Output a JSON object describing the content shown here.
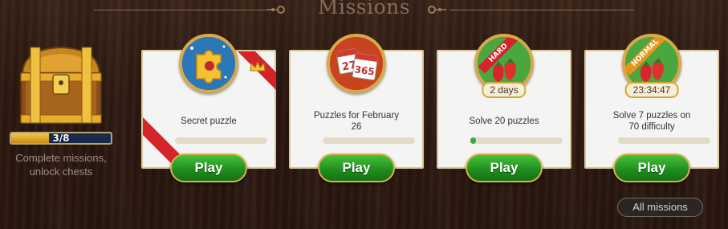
{
  "header": {
    "title": "Missions"
  },
  "chest": {
    "progress_label": "3/8",
    "progress_fraction": 0.375,
    "caption_line1": "Complete missions,",
    "caption_line2": "unlock chests"
  },
  "missions": [
    {
      "label": "Secret puzzle",
      "label2": "",
      "progress": 0,
      "play_label": "Play",
      "icon": "puzzle-piece-icon"
    },
    {
      "label": "Puzzles for February",
      "label2": "26",
      "progress": 0,
      "play_label": "Play",
      "icon": "calendar-icon",
      "cal_a": "27",
      "cal_b": "365"
    },
    {
      "label": "Solve 20 puzzles",
      "label2": "",
      "progress": 0.05,
      "play_label": "Play",
      "icon": "strawberry-icon",
      "ribbon": "HARD",
      "time_tag": "2 days"
    },
    {
      "label": "Solve 7 puzzles on",
      "label2": "70 difficulty",
      "progress": 0,
      "play_label": "Play",
      "icon": "strawberry-icon",
      "ribbon": "NORMAL",
      "time_tag": "23:34:47"
    }
  ],
  "all_missions_label": "All missions",
  "colors": {
    "accent_gold": "#d8a94a",
    "play_green": "#2a9a28",
    "ribbon_red": "#d6232a"
  }
}
